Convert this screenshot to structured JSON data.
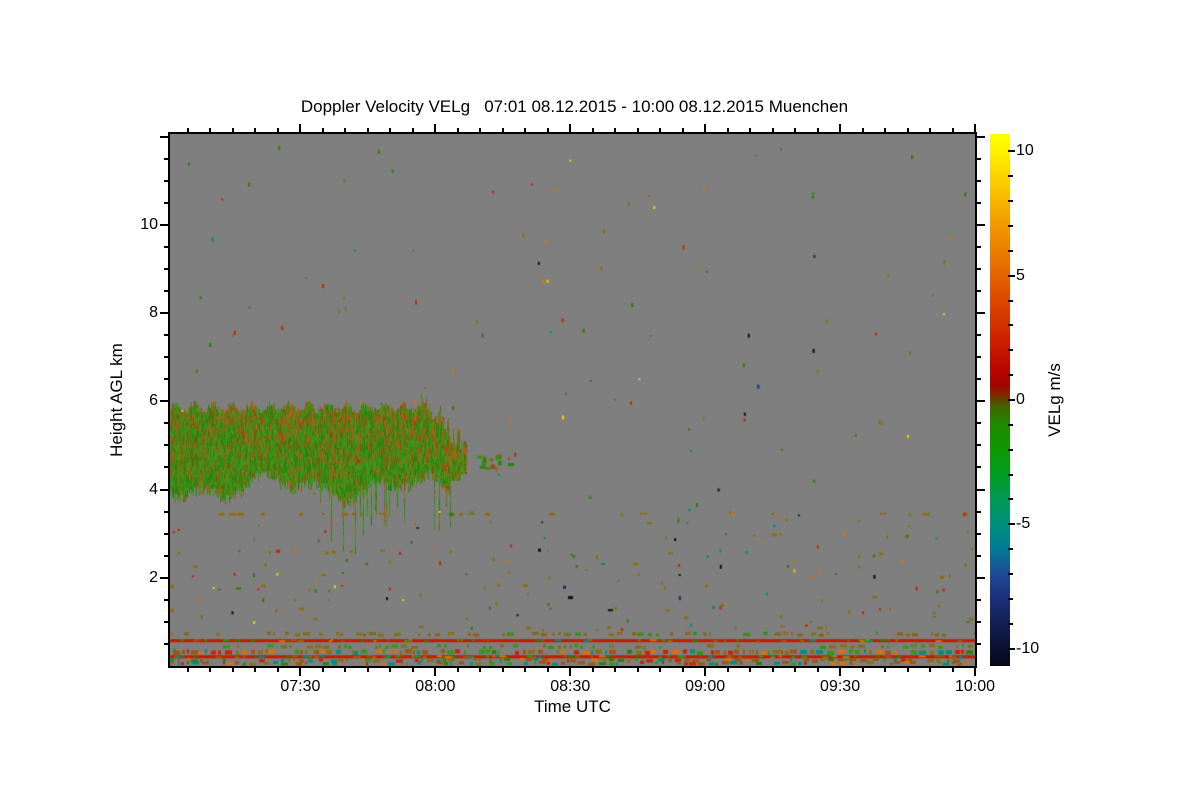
{
  "title": "Doppler Velocity VELg   07:01 08.12.2015 - 10:00 08.12.2015 Muenchen",
  "x_axis": {
    "label": "Time UTC",
    "start": "07:01",
    "end": "10:00",
    "ticks": [
      "07:30",
      "08:00",
      "08:30",
      "09:00",
      "09:30",
      "10:00"
    ],
    "tick_minutes": [
      29,
      59,
      89,
      119,
      149,
      179
    ],
    "minor_step_minutes": 5
  },
  "y_axis": {
    "label": "Height AGL km",
    "range_km": [
      0,
      12.06
    ],
    "ticks": [
      "2",
      "4",
      "6",
      "8",
      "10"
    ],
    "tick_values": [
      2,
      4,
      6,
      8,
      10
    ],
    "minor_step_km": 0.5
  },
  "colorbar": {
    "label": "VELg m/s",
    "range": [
      -10.7,
      10.7
    ],
    "ticks": [
      "10",
      "5",
      "0",
      "-5",
      "-10"
    ],
    "tick_values": [
      10,
      5,
      0,
      -5,
      -10
    ],
    "minor_step": 1,
    "gradient_stops": [
      {
        "f": 0.0,
        "c": "#ffff00"
      },
      {
        "f": 0.033,
        "c": "#fff200"
      },
      {
        "f": 0.079,
        "c": "#fcd400"
      },
      {
        "f": 0.126,
        "c": "#f7b600"
      },
      {
        "f": 0.173,
        "c": "#f29800"
      },
      {
        "f": 0.22,
        "c": "#ec7d00"
      },
      {
        "f": 0.266,
        "c": "#e56300"
      },
      {
        "f": 0.313,
        "c": "#dc4800"
      },
      {
        "f": 0.36,
        "c": "#d33000"
      },
      {
        "f": 0.407,
        "c": "#c81600"
      },
      {
        "f": 0.444,
        "c": "#b80500"
      },
      {
        "f": 0.472,
        "c": "#a00500"
      },
      {
        "f": 0.491,
        "c": "#7c2a00"
      },
      {
        "f": 0.5,
        "c": "#5f4400"
      },
      {
        "f": 0.514,
        "c": "#3f6600"
      },
      {
        "f": 0.547,
        "c": "#1e8a00"
      },
      {
        "f": 0.593,
        "c": "#0f9800"
      },
      {
        "f": 0.64,
        "c": "#009d20"
      },
      {
        "f": 0.687,
        "c": "#009a55"
      },
      {
        "f": 0.734,
        "c": "#008f7d"
      },
      {
        "f": 0.78,
        "c": "#007b95"
      },
      {
        "f": 0.827,
        "c": "#1d4a96"
      },
      {
        "f": 0.874,
        "c": "#1c2f7a"
      },
      {
        "f": 0.92,
        "c": "#131f52"
      },
      {
        "f": 0.967,
        "c": "#0a1130"
      },
      {
        "f": 1.0,
        "c": "#050818"
      }
    ]
  },
  "plot": {
    "background_color": "#7f7f7f",
    "frame_color": "#000000",
    "green_palette": [
      "#2e7e0c",
      "#35910f",
      "#3f8a12",
      "#2f9b14",
      "#49941c",
      "#27850a"
    ],
    "olive_palette": [
      "#8a6a12",
      "#965c10",
      "#a45312",
      "#b05a14",
      "#7e6c16",
      "#c05a10",
      "#9a4a0e"
    ],
    "speckle_palette": [
      "#8a7010",
      "#2e7d0a",
      "#cc2200",
      "#e07000",
      "#e8d000",
      "#008f7e",
      "#10306e",
      "#101010"
    ],
    "speckle_weights": [
      0.34,
      0.22,
      0.1,
      0.08,
      0.08,
      0.08,
      0.04,
      0.06
    ],
    "red_line_color": "#c31a00"
  },
  "chart_data": {
    "type": "heatmap",
    "title": "Doppler Velocity VELg   07:01 08.12.2015 - 10:00 08.12.2015 Muenchen",
    "site": "Muenchen",
    "date": "08.12.2015",
    "xlabel": "Time UTC",
    "ylabel": "Height AGL km",
    "x_range": [
      "07:01",
      "10:00"
    ],
    "x_ticks": [
      "07:30",
      "08:00",
      "08:30",
      "09:00",
      "09:30",
      "10:00"
    ],
    "y_range_km": [
      0,
      12
    ],
    "y_ticks_km": [
      2,
      4,
      6,
      8,
      10
    ],
    "value_label": "VELg m/s",
    "value_range_ms": [
      -10.7,
      10.7
    ],
    "value_ticks_ms": [
      -10,
      -5,
      0,
      5,
      10
    ],
    "no_signal_color": "gray",
    "features": [
      {
        "name": "mid-level-cloud-layer",
        "time_start": "07:01",
        "time_end": "08:07",
        "height_base_km": 3.9,
        "height_top_km": 5.9,
        "velocity_ms_range": [
          -2,
          2
        ],
        "description": "streaky green/olive cloud echo, Doppler velocity near 0 m/s with alternating weak up/down streaks; ragged virga tails to ~2.8 km after 07:40"
      },
      {
        "name": "detached-cloud-fragments",
        "time_start": "08:08",
        "time_end": "08:16",
        "height_km": 4.6,
        "velocity_ms": -1
      },
      {
        "name": "thin-dashed-layer",
        "height_km": 3.45,
        "time_start": "07:01",
        "time_end": "10:00",
        "velocity_ms": 0,
        "description": "broken olive dash line across whole record"
      },
      {
        "name": "boundary-layer-speckle",
        "height_range_km": [
          0.8,
          3.4
        ],
        "description": "sparse speckles in loose horizontal bands, mostly near-zero velocity (olive), few red/teal/yellow/black"
      },
      {
        "name": "near-surface-red-line-upper",
        "height_km": 0.58,
        "velocity_ms": 2,
        "time_start": "07:01",
        "time_end": "10:00",
        "description": "continuous red line"
      },
      {
        "name": "near-surface-red-line-lower",
        "height_km": 0.22,
        "velocity_ms": 2,
        "time_start": "07:01",
        "time_end": "10:00",
        "description": "continuous red line with colored interruptions"
      },
      {
        "name": "surface-mixed-bands",
        "height_range_km": [
          0.05,
          0.75
        ],
        "description": "dense broken bands of green/olive/red/teal pixels"
      },
      {
        "name": "random-speckle-noise",
        "description": "isolated colored pixels scattered over the full time-height domain"
      }
    ]
  }
}
